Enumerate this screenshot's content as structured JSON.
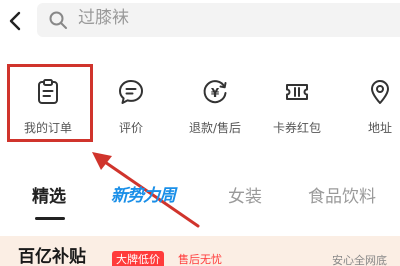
{
  "header": {
    "back_icon": "chevron-left-icon",
    "search_icon": "search-icon",
    "search_query": "过膝袜"
  },
  "shortcuts": [
    {
      "label": "我的订单",
      "icon": "clipboard-icon"
    },
    {
      "label": "评价",
      "icon": "comment-icon"
    },
    {
      "label": "退款/售后",
      "icon": "refund-icon"
    },
    {
      "label": "卡券红包",
      "icon": "ticket-icon"
    },
    {
      "label": "地址",
      "icon": "location-icon"
    }
  ],
  "tabs": [
    {
      "label": "精选",
      "active": true
    },
    {
      "label": "新势力周",
      "style": "promo"
    },
    {
      "label": "女装"
    },
    {
      "label": "食品饮料"
    }
  ],
  "promo_strip": {
    "title": "百亿补贴",
    "badge": "大牌低价",
    "badge2": "售后无忧",
    "right_text": "安心全网底"
  },
  "colors": {
    "highlight": "#d0342c",
    "promo_tab": "#1a8fe8",
    "badge": "#ff3b3b",
    "icon_stroke": "#333333"
  }
}
